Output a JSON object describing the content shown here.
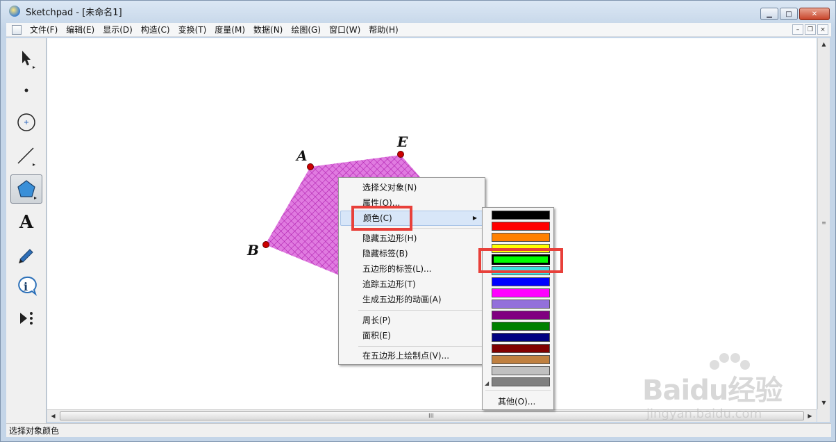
{
  "window": {
    "title": "Sketchpad  - [未命名1]",
    "controls": {
      "minimize": "▁",
      "maximize": "□",
      "close": "✕"
    }
  },
  "menubar": {
    "items": [
      "文件(F)",
      "编辑(E)",
      "显示(D)",
      "构造(C)",
      "变换(T)",
      "度量(M)",
      "数据(N)",
      "绘图(G)",
      "窗口(W)",
      "帮助(H)"
    ],
    "mdi_controls": {
      "minimize": "–",
      "restore": "❐",
      "close": "×"
    }
  },
  "toolbox": {
    "tools": [
      "arrow-tool",
      "point-tool",
      "compass-tool",
      "straightedge-tool",
      "polygon-tool",
      "text-tool",
      "marker-tool",
      "information-tool",
      "custom-tool"
    ],
    "active_tool": "polygon-tool",
    "text_tool_glyph": "A"
  },
  "figure": {
    "shape": "pentagon",
    "fill_color": "#cc33cc",
    "point_color": "#cc0000",
    "labels": {
      "A": "A",
      "B": "B",
      "E": "E"
    }
  },
  "context_menu": {
    "items": [
      {
        "label": "选择父对象(N)"
      },
      {
        "label": "属性(O)..."
      },
      {
        "label": "颜色(C)",
        "has_submenu": true,
        "submenu_arrow": "▶"
      },
      {
        "label": "隐藏五边形(H)"
      },
      {
        "label": "隐藏标签(B)"
      },
      {
        "label": "五边形的标签(L)..."
      },
      {
        "label": "追踪五边形(T)"
      },
      {
        "label": "生成五边形的动画(A)"
      },
      {
        "label": "周长(P)"
      },
      {
        "label": "面积(E)"
      },
      {
        "label": "在五边形上绘制点(V)..."
      }
    ]
  },
  "color_submenu": {
    "swatches": [
      "#000000",
      "#ff0000",
      "#ff8000",
      "#ffff00",
      "#00ff00",
      "#40e0e0",
      "#0000ff",
      "#ff00ff",
      "#9370db",
      "#800080",
      "#008000",
      "#000080",
      "#800000",
      "#c08040",
      "#c0c0c0",
      "#808080"
    ],
    "selected_color": "#00ff00",
    "other_label": "其他(O)...",
    "grip": "◢"
  },
  "scrollbars": {
    "up": "▲",
    "down": "▼",
    "left": "◀",
    "right": "▶",
    "v_grip": "≡",
    "h_grip": "III"
  },
  "status_bar": {
    "text": "选择对象颜色"
  },
  "watermark": {
    "brand": "Baidu经验",
    "domain": "jingyan.baidu.com"
  }
}
